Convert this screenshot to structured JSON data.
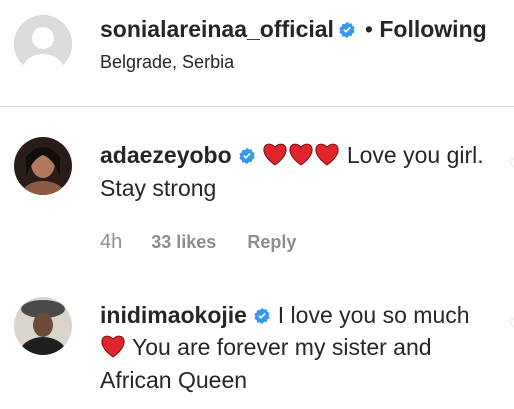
{
  "post_header": {
    "username": "sonialareinaa_official",
    "separator": "•",
    "follow_label": "Following",
    "location": "Belgrade, Serbia",
    "avatar_icon": "default-avatar-icon"
  },
  "comments": [
    {
      "username": "adaezeyobo",
      "verified": true,
      "hearts": 3,
      "text_after_hearts": " Love you girl. Stay strong",
      "age": "4h",
      "likes": "33 likes",
      "reply_label": "Reply"
    },
    {
      "username": "inidimaokojie",
      "verified": true,
      "text_before_heart": " I love you so much",
      "text_after_heart": " You are forever my sister and African Queen"
    }
  ],
  "colors": {
    "verified_blue": "#3897f0",
    "heart_red": "#e0242c",
    "muted_text": "#8e8e8e",
    "divider": "#dbdbdb"
  }
}
